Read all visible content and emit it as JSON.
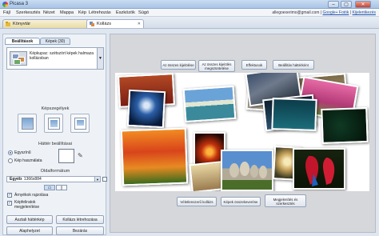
{
  "window": {
    "title": "Picasa 3",
    "min": "–",
    "max": "▢",
    "close": "✕"
  },
  "menu": {
    "items": [
      "Fájl",
      "Szerkesztés",
      "Nézet",
      "Mappa",
      "Kép",
      "Létrehozás",
      "Eszközök",
      "Súgó"
    ],
    "user_email": "allegoexerimo@gmail.com",
    "separator": "|",
    "link1": "Google+ Fotók",
    "link2": "Kijelentkezés"
  },
  "tabs": [
    {
      "label": "Könyvtár"
    },
    {
      "label": "Kollázs",
      "close": "✕"
    }
  ],
  "left_panel": {
    "subtab_settings": "Beállítások",
    "subtab_pictures": "Képek (30)",
    "collage_type": "Képkupac: szétszórt képek halmaza kollázsban",
    "collage_type_arrow": "▼",
    "border_title": "Képszegélyek",
    "background_title": "Háttér beállításai",
    "solid_color": "Egyszínű",
    "use_image": "Kép használata",
    "picker_icon": "✎",
    "format_title": "Oldalformátum",
    "format_value_bold": "Egyéb",
    "format_value_rest": ": 1366x884",
    "format_arrow": "▼",
    "shadows": "Árnyékok rajzolása",
    "captions": "Képfeliratok megjelenítése",
    "check_mark": "✓",
    "btn_set_background": "Asztali háttérkép",
    "btn_create": "Kollázs létrehozása",
    "btn_default": "Alaphelyzet",
    "btn_close": "Bezárás"
  },
  "toolbar": {
    "select_all": "Az összes kijelölése",
    "select_all_show": "Az összes kijelölés megszüntetése",
    "effects": "Effektusok",
    "bg_settings": "Beállítás háttérként"
  },
  "bottom_bar": {
    "shuffle": "Véletlenszerű kollázs",
    "shuffle_images": "Képek összekeverése",
    "shuffle_sizes": "Megjelenítés és szerkesztés"
  },
  "colors": {
    "accent": "#2b63b8",
    "canvas_bg": "#ffffff",
    "main_bg": "#d5d7da"
  }
}
